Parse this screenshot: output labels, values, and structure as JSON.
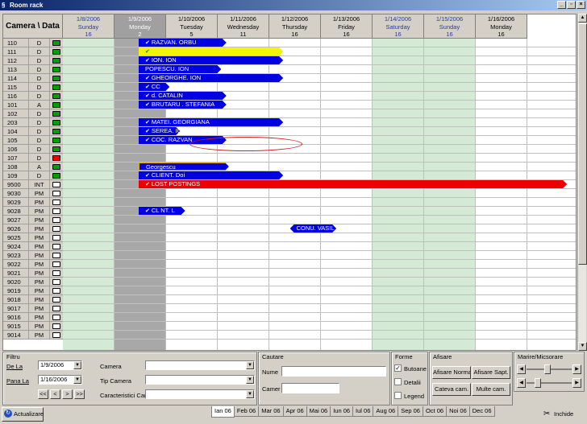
{
  "window": {
    "title": "Room rack"
  },
  "rack": {
    "corner_label": "Camera \\ Data",
    "dates": [
      {
        "date": "1/8/2006",
        "day": "Sunday",
        "num": "16",
        "kind": "wkend"
      },
      {
        "date": "1/9/2006",
        "day": "Monday",
        "num": "2",
        "kind": "today"
      },
      {
        "date": "1/10/2006",
        "day": "Tuesday",
        "num": "5",
        "kind": "normal"
      },
      {
        "date": "1/11/2006",
        "day": "Wednesday",
        "num": "11",
        "kind": "normal"
      },
      {
        "date": "1/12/2006",
        "day": "Thursday",
        "num": "16",
        "kind": "normal"
      },
      {
        "date": "1/13/2006",
        "day": "Friday",
        "num": "16",
        "kind": "normal"
      },
      {
        "date": "1/14/2006",
        "day": "Saturday",
        "num": "16",
        "kind": "wkend"
      },
      {
        "date": "1/15/2006",
        "day": "Sunday",
        "num": "16",
        "kind": "wkend"
      },
      {
        "date": "1/16/2006",
        "day": "Monday",
        "num": "16",
        "kind": "normal"
      }
    ],
    "rooms": [
      {
        "num": "110",
        "type": "D",
        "status": "green"
      },
      {
        "num": "111",
        "type": "D",
        "status": "green"
      },
      {
        "num": "112",
        "type": "D",
        "status": "green"
      },
      {
        "num": "113",
        "type": "D",
        "status": "green"
      },
      {
        "num": "114",
        "type": "D",
        "status": "green"
      },
      {
        "num": "115",
        "type": "D",
        "status": "green"
      },
      {
        "num": "116",
        "type": "D",
        "status": "green"
      },
      {
        "num": "101",
        "type": "A",
        "status": "green"
      },
      {
        "num": "102",
        "type": "D",
        "status": "green"
      },
      {
        "num": "203",
        "type": "D",
        "status": "green"
      },
      {
        "num": "104",
        "type": "D",
        "status": "green"
      },
      {
        "num": "105",
        "type": "D",
        "status": "green"
      },
      {
        "num": "106",
        "type": "D",
        "status": "green"
      },
      {
        "num": "107",
        "type": "D",
        "status": "red"
      },
      {
        "num": "108",
        "type": "A",
        "status": "green"
      },
      {
        "num": "109",
        "type": "D",
        "status": "green"
      },
      {
        "num": "9500",
        "type": "INT",
        "status": "empty"
      },
      {
        "num": "9030",
        "type": "PM",
        "status": "empty"
      },
      {
        "num": "9029",
        "type": "PM",
        "status": "empty"
      },
      {
        "num": "9028",
        "type": "PM",
        "status": "empty"
      },
      {
        "num": "9027",
        "type": "PM",
        "status": "empty"
      },
      {
        "num": "9026",
        "type": "PM",
        "status": "empty"
      },
      {
        "num": "9025",
        "type": "PM",
        "status": "empty"
      },
      {
        "num": "9024",
        "type": "PM",
        "status": "empty"
      },
      {
        "num": "9023",
        "type": "PM",
        "status": "empty"
      },
      {
        "num": "9022",
        "type": "PM",
        "status": "empty"
      },
      {
        "num": "9021",
        "type": "PM",
        "status": "empty"
      },
      {
        "num": "9020",
        "type": "PM",
        "status": "empty"
      },
      {
        "num": "9019",
        "type": "PM",
        "status": "empty"
      },
      {
        "num": "9018",
        "type": "PM",
        "status": "empty"
      },
      {
        "num": "9017",
        "type": "PM",
        "status": "empty"
      },
      {
        "num": "9016",
        "type": "PM",
        "status": "empty"
      },
      {
        "num": "9015",
        "type": "PM",
        "status": "empty"
      },
      {
        "num": "9014",
        "type": "PM",
        "status": "empty"
      }
    ],
    "bookings": [
      {
        "row": 0,
        "start": 1.0,
        "end": 2.7,
        "label": "RAZVAN. ORBU",
        "color": "blue",
        "check": true
      },
      {
        "row": 1,
        "start": 1.0,
        "end": 3.8,
        "label": "",
        "color": "yellow",
        "check": true
      },
      {
        "row": 2,
        "start": 1.0,
        "end": 3.8,
        "label": "ION. ION",
        "color": "blue",
        "check": true
      },
      {
        "row": 3,
        "start": 1.0,
        "end": 2.6,
        "label": "POPESCU. ION",
        "color": "blue",
        "check": false
      },
      {
        "row": 4,
        "start": 1.0,
        "end": 3.8,
        "label": "GHEORGHE. ION",
        "color": "blue",
        "check": true
      },
      {
        "row": 5,
        "start": 1.0,
        "end": 1.6,
        "label": "CC",
        "color": "blue",
        "check": true
      },
      {
        "row": 6,
        "start": 1.0,
        "end": 2.7,
        "label": "d. CATALIN",
        "color": "blue",
        "check": true
      },
      {
        "row": 7,
        "start": 1.0,
        "end": 2.7,
        "label": "BRUTARU . STEFANIA",
        "color": "blue",
        "check": true
      },
      {
        "row": 9,
        "start": 1.0,
        "end": 3.8,
        "label": "MATEI. GEORGIANA",
        "color": "blue",
        "check": true
      },
      {
        "row": 10,
        "start": 1.0,
        "end": 1.8,
        "label": "SEREA. IO",
        "color": "blue",
        "check": true
      },
      {
        "row": 11,
        "start": 1.0,
        "end": 2.7,
        "label": "COC. RAZVAN",
        "color": "blue",
        "check": true
      },
      {
        "row": 14,
        "start": 1.0,
        "end": 2.75,
        "label": "Georgescu",
        "color": "outline",
        "check": false
      },
      {
        "row": 15,
        "start": 1.0,
        "end": 3.8,
        "label": "CLIENT. Doi",
        "color": "blue",
        "check": true
      },
      {
        "row": 16,
        "start": 1.0,
        "end": 9.3,
        "label": "LOST POSTINGS",
        "color": "red",
        "check": true
      },
      {
        "row": 19,
        "start": 1.0,
        "end": 1.9,
        "label": "CL    NT. L",
        "color": "blue",
        "check": true
      },
      {
        "row": 21,
        "start": 4.4,
        "end": 5.3,
        "label": "CONU. VASIL",
        "color": "hex",
        "check": false
      }
    ]
  },
  "filter": {
    "title": "Filtru",
    "de_la_label": "De La",
    "de_la_value": "1/9/2006",
    "pana_la_label": "Pana La",
    "pana_la_value": "1/16/2006",
    "nav_buttons": [
      "<<",
      "<",
      ">",
      ">>"
    ],
    "camera_label": "Camera",
    "camera_value": "",
    "tip_camera_label": "Tip Camera",
    "tip_camera_value": "",
    "caracteristici_label": "Caracteristici Cam",
    "caracteristici_value": ""
  },
  "cautare": {
    "title": "Cautare",
    "nume_label": "Nume",
    "nume_value": "",
    "camera_label": "Camer",
    "camera_value": ""
  },
  "forme": {
    "title": "Forme",
    "butoane_label": "Butoane",
    "butoane_checked": true,
    "detalii_label": "Detalii",
    "detalii_checked": false,
    "legend_label": "Legend",
    "legend_checked": false
  },
  "afisare": {
    "title": "Afisare",
    "buttons": [
      "Afisare Normal",
      "Afisare Sapt.",
      "Cateva cam.",
      "Multe cam."
    ]
  },
  "zoom": {
    "title": "Marire/Micsorare",
    "level1": 0.45,
    "level2": 0.2
  },
  "bottom": {
    "refresh_label": "Actualizare",
    "close_label": "Inchide"
  },
  "months": [
    "Ian 06",
    "Feb 06",
    "Mar 06",
    "Apr 06",
    "Mai 06",
    "Iun 06",
    "Iul 06",
    "Aug 06",
    "Sep 06",
    "Oct 06",
    "Noi 06",
    "Dec 06"
  ],
  "active_month": 0,
  "colors": {
    "green": "#00a000",
    "red": "#ee0000",
    "blue": "#0000e0",
    "weekend": "#d4ead4"
  }
}
